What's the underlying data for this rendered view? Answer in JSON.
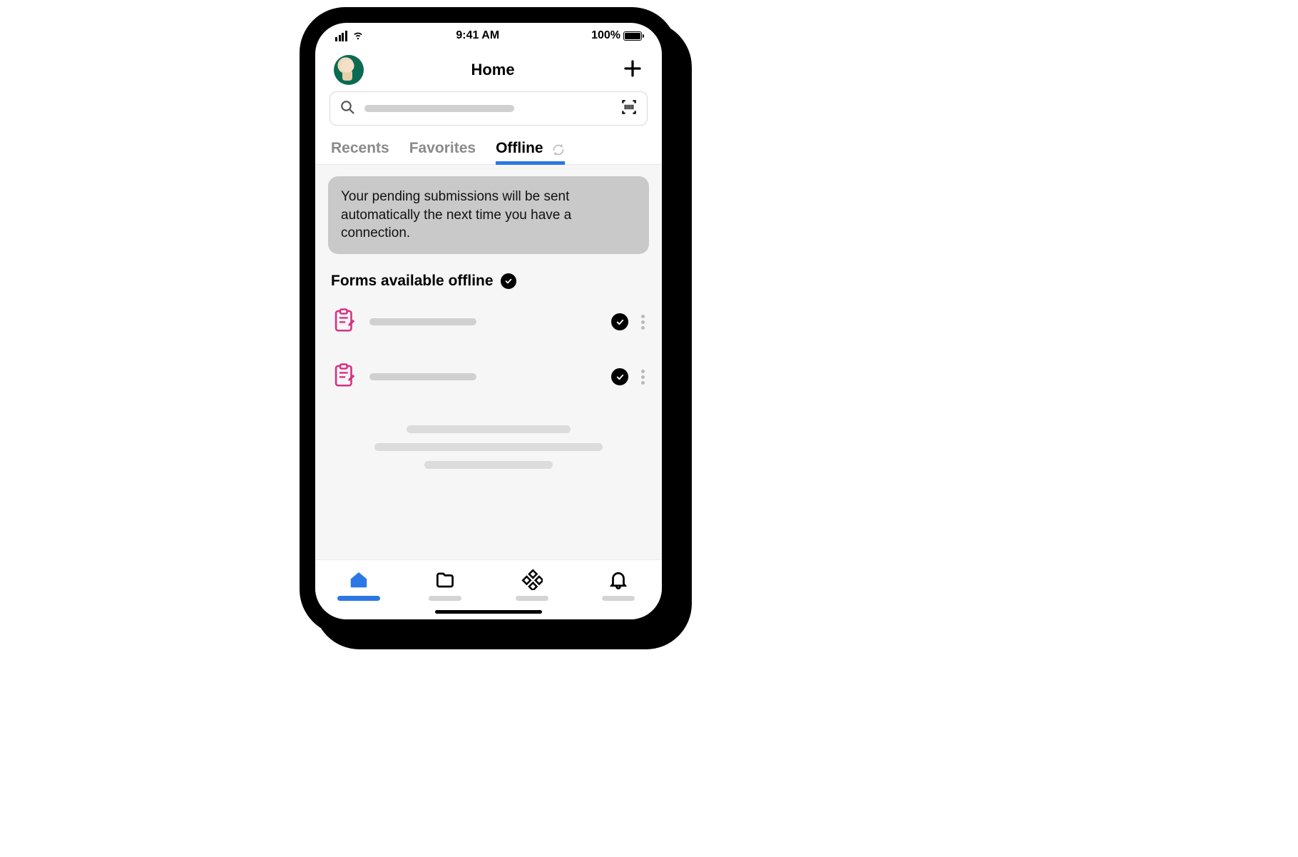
{
  "status_bar": {
    "time": "9:41 AM",
    "battery_text": "100%"
  },
  "header": {
    "title": "Home"
  },
  "tabs": {
    "items": [
      "Recents",
      "Favorites",
      "Offline"
    ],
    "active_index": 2
  },
  "offline": {
    "info_message": "Your pending submissions will be sent automatically the next time you have a connection.",
    "section_title": "Forms available offline",
    "forms": [
      {
        "status": "synced"
      },
      {
        "status": "synced"
      }
    ]
  },
  "colors": {
    "accent": "#2b78e4",
    "form_icon": "#d63384"
  }
}
